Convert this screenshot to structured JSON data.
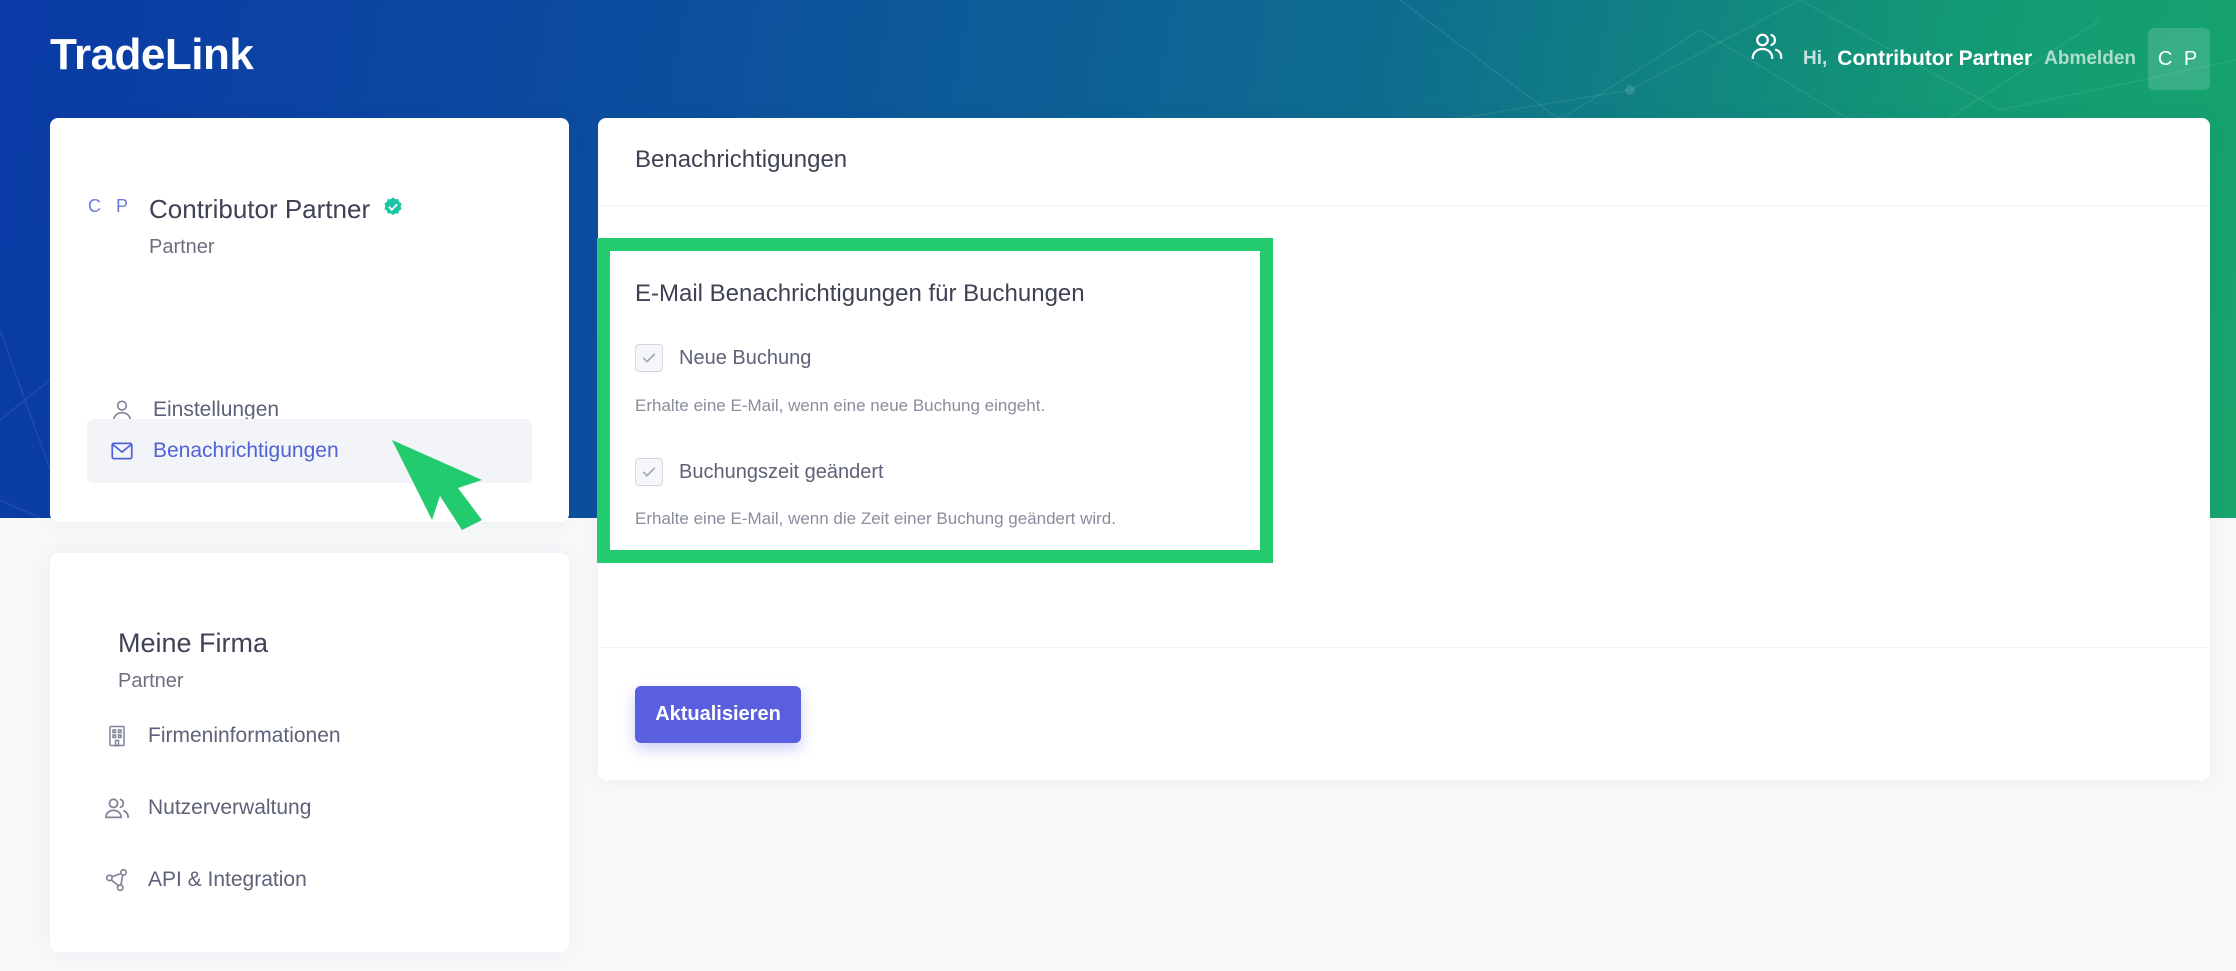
{
  "app": {
    "brand": "TradeLink"
  },
  "topbar": {
    "greeting": "Hi,",
    "user_name": "Contributor Partner",
    "logout_label": "Abmelden",
    "avatar_initials": "C P"
  },
  "profile": {
    "initials": "C P",
    "name": "Contributor Partner",
    "role": "Partner",
    "verified_icon": "verified-badge-icon"
  },
  "sidebar": {
    "items": [
      {
        "label": "Einstellungen",
        "icon": "user-icon",
        "active": false
      },
      {
        "label": "Benachrichtigungen",
        "icon": "mail-icon",
        "active": true
      }
    ]
  },
  "company": {
    "title": "Meine Firma",
    "role": "Partner",
    "items": [
      {
        "label": "Firmeninformationen",
        "icon": "building-icon"
      },
      {
        "label": "Nutzerverwaltung",
        "icon": "users-icon"
      },
      {
        "label": "API & Integration",
        "icon": "share-nodes-icon"
      }
    ]
  },
  "main": {
    "title": "Benachrichtigungen",
    "section_title": "E-Mail Benachrichtigungen für Buchungen",
    "options": [
      {
        "label": "Neue Buchung",
        "checked": true,
        "help": "Erhalte eine E-Mail, wenn eine neue Buchung eingeht."
      },
      {
        "label": "Buchungszeit geändert",
        "checked": true,
        "help": "Erhalte eine E-Mail, wenn die Zeit einer Buchung geändert wird."
      }
    ],
    "submit_label": "Aktualisieren"
  },
  "colors": {
    "accent": "#5a5fe0",
    "active_link": "#4f63d7",
    "highlight": "#22cc6e",
    "verified": "#1bc5a4"
  }
}
